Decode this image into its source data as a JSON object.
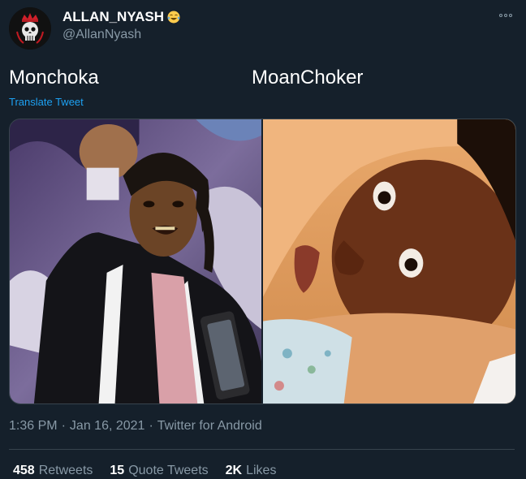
{
  "author": {
    "display_name": "ALLAN_NYASH",
    "handle": "@AllanNyash",
    "emoji": "face-with-tears-of-joy-icon",
    "avatar": "crowned-skull-icon"
  },
  "tweet": {
    "caption_left": "Monchoka",
    "caption_right": "MoanChoker",
    "translate_label": "Translate Tweet"
  },
  "media": [
    {
      "icon": "photo-man-pointing"
    },
    {
      "icon": "photo-man-lying-on-pillow"
    }
  ],
  "meta": {
    "time": "1:36 PM",
    "separator": "·",
    "date": "Jan 16, 2021",
    "source": "Twitter for Android"
  },
  "stats": {
    "retweets_count": "458",
    "retweets_label": "Retweets",
    "quotes_count": "15",
    "quotes_label": "Quote Tweets",
    "likes_count": "2K",
    "likes_label": "Likes"
  },
  "colors": {
    "background": "#15202b",
    "secondary_text": "#8899a6",
    "link": "#1da1f2",
    "border": "#38444d"
  }
}
